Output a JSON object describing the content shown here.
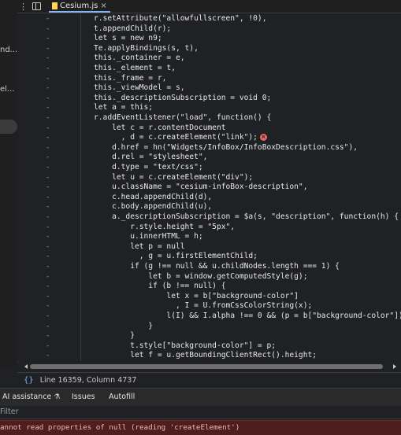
{
  "left_panel": {
    "snippets": [
      "nd...",
      "el..."
    ]
  },
  "tabbar": {
    "more_icon": "⋮",
    "active_tab": "Cesium.js",
    "close_glyph": "×"
  },
  "code": {
    "gutter_marker": "-",
    "lines": [
      "r.setAttribute(\"allowfullscreen\", !0),",
      "t.appendChild(r);",
      "let s = new n9;",
      "Te.applyBindings(s, t),",
      "this._container = e,",
      "this._element = t,",
      "this._frame = r,",
      "this._viewModel = s,",
      "this._descriptionSubscription = void 0;",
      "let a = this;",
      "r.addEventListener(\"load\", function() {",
      "    let c = r.contentDocument",
      "      , d = c.createElement(\"link\");",
      "    d.href = hn(\"Widgets/InfoBox/InfoBoxDescription.css\"),",
      "    d.rel = \"stylesheet\",",
      "    d.type = \"text/css\";",
      "    let u = c.createElement(\"div\");",
      "    u.className = \"cesium-infoBox-description\",",
      "    c.head.appendChild(d),",
      "    c.body.appendChild(u),",
      "    a._descriptionSubscription = $a(s, \"description\", function(h) {",
      "        r.style.height = \"5px\",",
      "        u.innerHTML = h;",
      "        let p = null",
      "          , g = u.firstElementChild;",
      "        if (g !== null && u.childNodes.length === 1) {",
      "            let b = window.getComputedStyle(g);",
      "            if (b !== null) {",
      "                let x = b[\"background-color\"]",
      "                  , I = U.fromCssColorString(x);",
      "                l(I) && I.alpha !== 0 && (p = b[\"background-color\"])",
      "            }",
      "        }",
      "        t.style[\"background-color\"] = p;",
      "        let f = u.getBoundingClientRect().height;",
      "        r.style.height = f + \"px\""
    ],
    "error_line_index": 12,
    "error_glyph": "×"
  },
  "statusbar": {
    "braces": "{}",
    "position": "Line 16359, Column 4737"
  },
  "drawer": {
    "tabs": [
      "AI assistance",
      "Issues",
      "Autofill"
    ],
    "ai_icon": "⚗"
  },
  "filter": {
    "label": "Filter"
  },
  "console": {
    "error_message": "annot read properties of null (reading 'createElement')"
  },
  "colors": {
    "accent": "#8ab4f8",
    "error_bg": "#4e1e1e",
    "error_text": "#f4b6b1",
    "error_icon": "#e46962"
  }
}
